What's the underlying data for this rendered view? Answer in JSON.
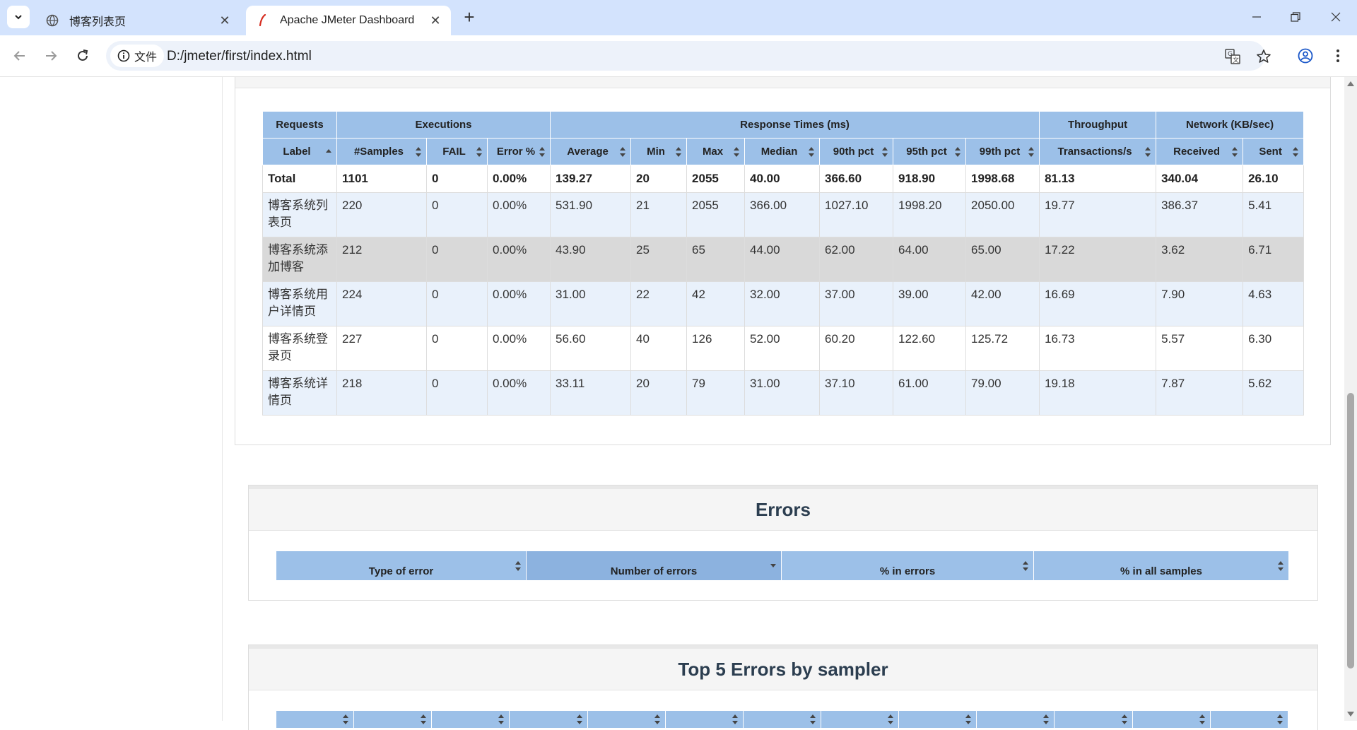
{
  "browser": {
    "tabs": [
      {
        "title": "博客列表页",
        "active": false,
        "icon": "globe-icon"
      },
      {
        "title": "Apache JMeter Dashboard",
        "active": true,
        "icon": "jmeter-feather-icon"
      }
    ],
    "site_chip": "文件",
    "url": "D:/jmeter/first/index.html"
  },
  "stats_table": {
    "group_headers": [
      "Requests",
      "Executions",
      "Response Times (ms)",
      "Throughput",
      "Network (KB/sec)"
    ],
    "columns": [
      "Label",
      "#Samples",
      "FAIL",
      "Error %",
      "Average",
      "Min",
      "Max",
      "Median",
      "90th pct",
      "95th pct",
      "99th pct",
      "Transactions/s",
      "Received",
      "Sent"
    ],
    "total": [
      "Total",
      "1101",
      "0",
      "0.00%",
      "139.27",
      "20",
      "2055",
      "40.00",
      "366.60",
      "918.90",
      "1998.68",
      "81.13",
      "340.04",
      "26.10"
    ],
    "rows": [
      [
        "博客系统列表页",
        "220",
        "0",
        "0.00%",
        "531.90",
        "21",
        "2055",
        "366.00",
        "1027.10",
        "1998.20",
        "2050.00",
        "19.77",
        "386.37",
        "5.41"
      ],
      [
        "博客系统添加博客",
        "212",
        "0",
        "0.00%",
        "43.90",
        "25",
        "65",
        "44.00",
        "62.00",
        "64.00",
        "65.00",
        "17.22",
        "3.62",
        "6.71"
      ],
      [
        "博客系统用户详情页",
        "224",
        "0",
        "0.00%",
        "31.00",
        "22",
        "42",
        "32.00",
        "37.00",
        "39.00",
        "42.00",
        "16.69",
        "7.90",
        "4.63"
      ],
      [
        "博客系统登录页",
        "227",
        "0",
        "0.00%",
        "56.60",
        "40",
        "126",
        "52.00",
        "60.20",
        "122.60",
        "125.72",
        "16.73",
        "5.57",
        "6.30"
      ],
      [
        "博客系统详情页",
        "218",
        "0",
        "0.00%",
        "33.11",
        "20",
        "79",
        "31.00",
        "37.10",
        "61.00",
        "79.00",
        "19.18",
        "7.87",
        "5.62"
      ]
    ]
  },
  "errors_panel": {
    "title": "Errors",
    "columns": [
      "Type of error",
      "Number of errors",
      "% in errors",
      "% in all samples"
    ]
  },
  "top5_panel": {
    "title": "Top 5 Errors by sampler"
  }
}
